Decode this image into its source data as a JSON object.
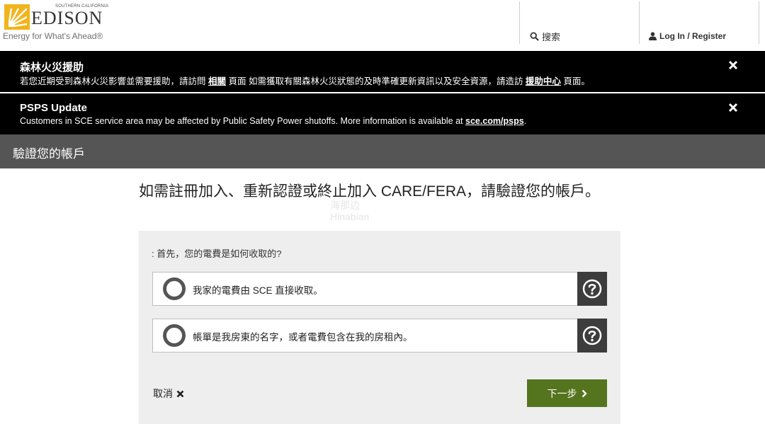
{
  "header": {
    "logo": {
      "small_text": "SOUTHERN CALIFORNIA",
      "wordmark": "EDISON",
      "tagline": "Energy for What's Ahead®"
    },
    "search_label": "搜索",
    "login_label": "Log In / Register"
  },
  "alerts": [
    {
      "title": "森林火災援助",
      "body_part1": "若您近期受到森林火災影響並需要援助，請訪問 ",
      "link1": "相關",
      "body_part2": " 頁面 如需獲取有關森林火災狀態的及時準確更新資訊以及安全資源，請造訪 ",
      "link2": "援助中心",
      "body_part3": " 頁面。"
    },
    {
      "title": "PSPS Update",
      "body_part1": "Customers in SCE service area may be affected by Public Safety Power shutoffs. More information is available at ",
      "link1": "sce.com/psps",
      "body_part2": "."
    }
  ],
  "titlebar": {
    "title": "驗證您的帳戶"
  },
  "main": {
    "heading": "如需註冊加入、重新認證或終止加入 CARE/FERA，請驗證您的帳戶。",
    "watermark_line1": "海那边",
    "watermark_line2": "Hinabian",
    "question": ": 首先，您的電費是如何收取的?",
    "options": [
      {
        "label": "我家的電費由 SCE 直接收取。"
      },
      {
        "label": "帳單是我房東的名字，或者電費包含在我的房租內。"
      }
    ],
    "cancel_label": "取消",
    "next_label": "下一步"
  },
  "colors": {
    "alert_bg": "#000000",
    "titlebar_bg": "#555555",
    "panel_bg": "#eeeeee",
    "next_button": "#55741e",
    "help_bg": "#3d3d3d",
    "logo_yellow": "#f2b41c"
  },
  "icons": {
    "search": "search-icon",
    "user": "user-icon",
    "close": "close-icon",
    "help": "question-circle-icon",
    "cancel": "x-icon",
    "next": "chevron-right-icon"
  }
}
